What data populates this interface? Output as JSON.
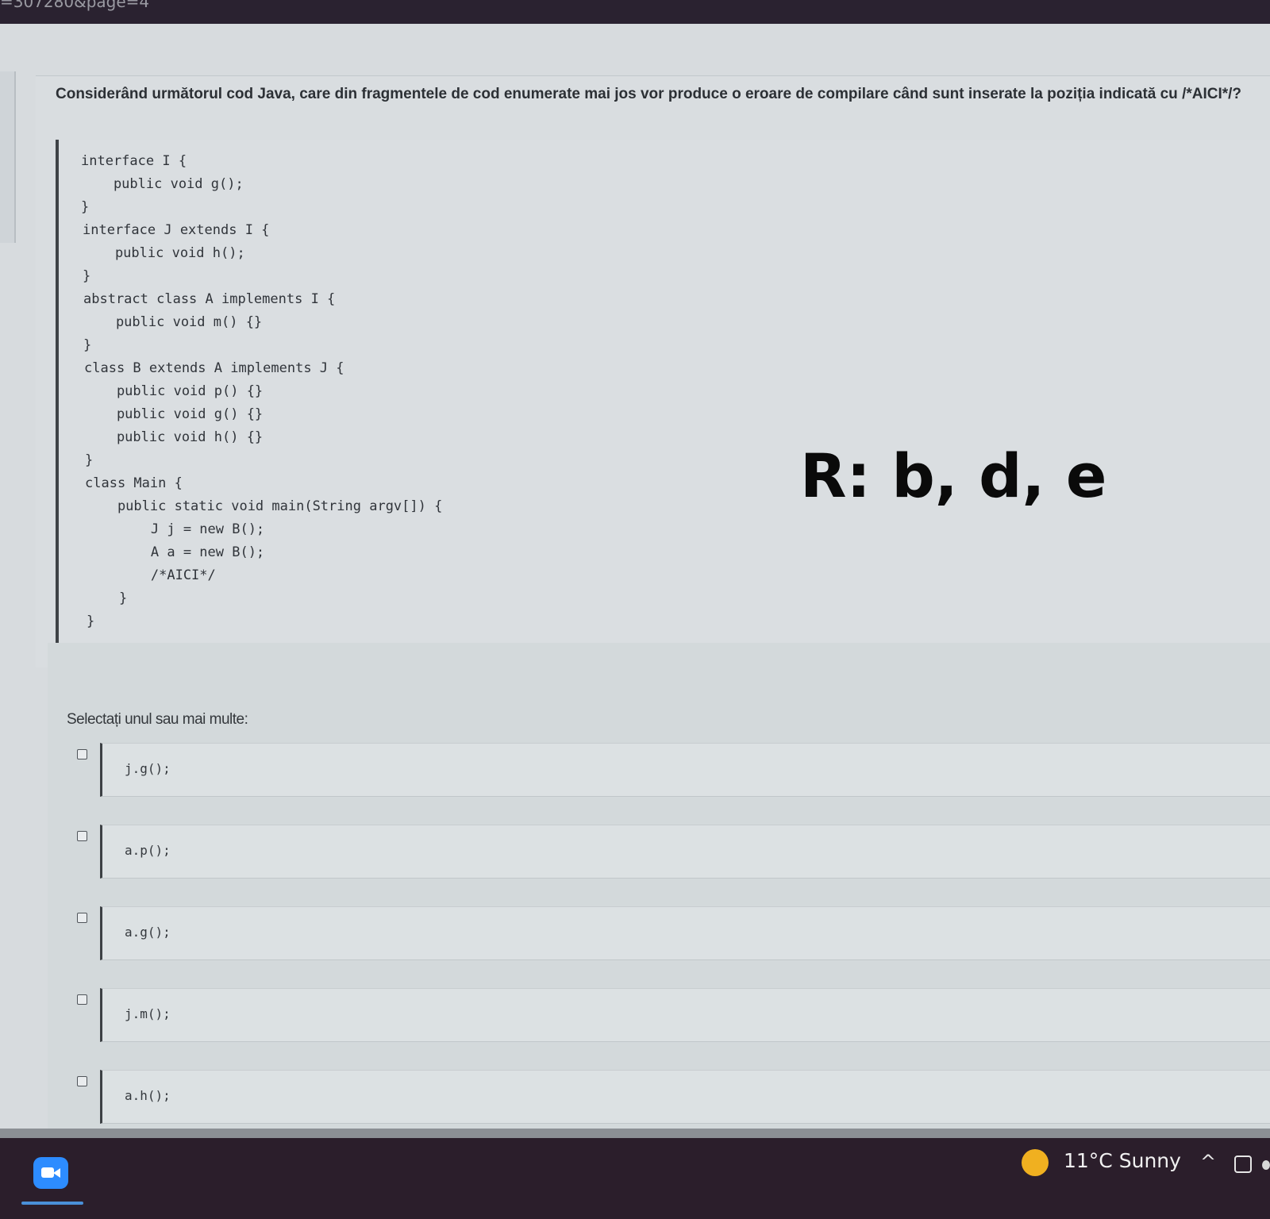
{
  "browser": {
    "url_fragment": "=307280&page=4"
  },
  "question": {
    "text": "Considerând următorul cod Java, care din fragmentele de cod enumerate mai jos vor produce o eroare de compilare când sunt inserate la poziția indicată cu /*AICI*/?",
    "code_lines": [
      "interface I {",
      "    public void g();",
      "}",
      "interface J extends I {",
      "    public void h();",
      "}",
      "abstract class A implements I {",
      "    public void m() {}",
      "}",
      "class B extends A implements J {",
      "    public void p() {}",
      "    public void g() {}",
      "    public void h() {}",
      "}",
      "class Main {",
      "    public static void main(String argv[]) {",
      "        J j = new B();",
      "        A a = new B();",
      "        /*AICI*/",
      "    }",
      "}"
    ]
  },
  "annotation": {
    "answer_note": "R: b, d, e"
  },
  "answers": {
    "prompt": "Selectați unul sau mai multe:",
    "options": [
      {
        "code": "j.g();",
        "checked": false
      },
      {
        "code": "a.p();",
        "checked": false
      },
      {
        "code": "a.g();",
        "checked": false
      },
      {
        "code": "j.m();",
        "checked": false
      },
      {
        "code": "a.h();",
        "checked": false
      }
    ]
  },
  "taskbar": {
    "weather_temp": "11°C",
    "weather_condition": "Sunny",
    "tray_chevron": "^",
    "icons": [
      "zoom-app-icon",
      "sun-icon",
      "chevron-up-icon",
      "meet-now-icon"
    ]
  },
  "colors": {
    "zoom_blue": "#2d8cff",
    "sun_yellow": "#f0b020",
    "taskbar_bg": "#2b1e2b"
  }
}
